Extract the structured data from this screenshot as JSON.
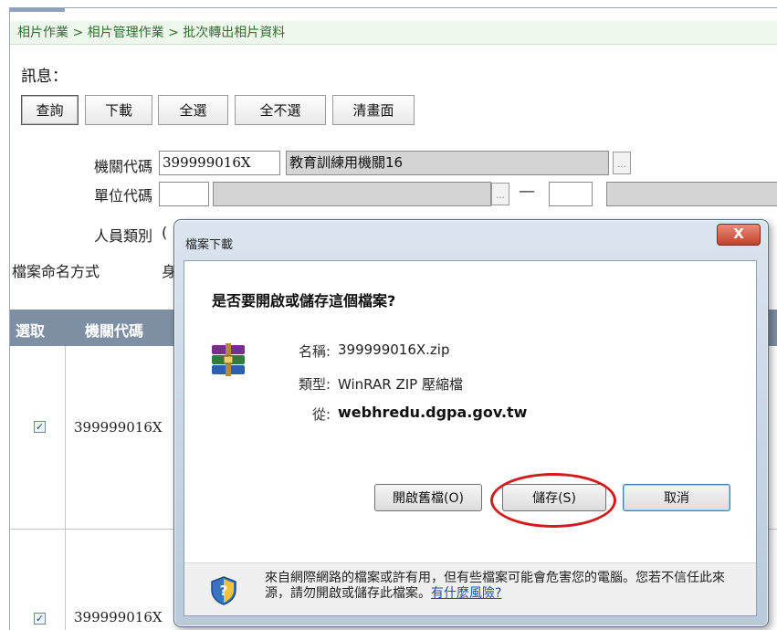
{
  "breadcrumb": "相片作業 > 相片管理作業 > 批次轉出相片資料",
  "message_label": "訊息：",
  "toolbar": {
    "query": "查詢",
    "download": "下載",
    "select_all": "全選",
    "select_none": "全不選",
    "clear": "清畫面"
  },
  "form": {
    "agency_code_label": "機關代碼",
    "agency_code_value": "399999016X",
    "agency_name_value": "教育訓練用機關16",
    "unit_code_label": "單位代碼",
    "unit_dash": "—",
    "staff_type_label": "人員類別",
    "file_naming_label": "檔案命名方式",
    "file_naming_value": "身",
    "staff_type_value": "("
  },
  "grid": {
    "col_select": "選取",
    "col_agency_code": "機關代碼",
    "rows": [
      {
        "checked": "✓",
        "code": "399999016X"
      },
      {
        "checked": "✓",
        "code": "399999016X"
      }
    ]
  },
  "dialog": {
    "title": "檔案下載",
    "close": "X",
    "question": "是否要開啟或儲存這個檔案?",
    "name_label": "名稱:",
    "name_value": "399999016X.zip",
    "type_label": "類型:",
    "type_value": "WinRAR ZIP 壓縮檔",
    "from_label": "從:",
    "from_value": "webhredu.dgpa.gov.tw",
    "open_button": "開啟舊檔(O)",
    "save_button": "儲存(S)",
    "cancel_button": "取消",
    "warning_text": "來自網際網路的檔案或許有用，但有些檔案可能會危害您的電腦。您若不信任此來源，請勿開啟或儲存此檔案。",
    "warning_link": "有什麼風險?"
  },
  "icons": {
    "archive": "winrar-archive-icon",
    "shield": "security-shield-icon",
    "picker": "ellipsis-picker-icon"
  },
  "colors": {
    "breadcrumb_bg": "#eef7ec",
    "grid_header": "#7e8fa3",
    "annotation_ring": "#d41a1a",
    "close_button": "#c4412c"
  }
}
